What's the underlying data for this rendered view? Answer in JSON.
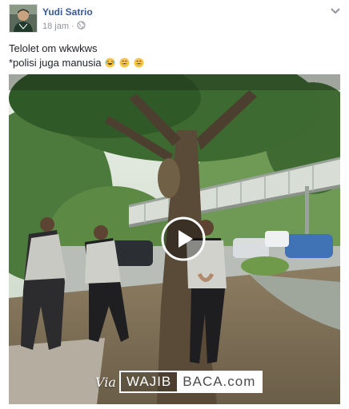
{
  "post": {
    "author": "Yudi Satrio",
    "time": "18 jam",
    "separator": "·",
    "privacy_icon": "globe-icon",
    "menu_icon": "chevron-down-icon",
    "text_line1": "Telolet om wkwkws",
    "text_line2": "*polisi juga manusia",
    "emojis": [
      "laughing-emoji",
      "grinning-emoji",
      "grinning-emoji"
    ]
  },
  "video": {
    "play_icon": "play-icon",
    "watermark": {
      "via": "Via",
      "part1": "WAJIB",
      "part2": "BACA.com"
    }
  },
  "colors": {
    "link": "#365899",
    "meta": "#90949c",
    "text": "#1d2129"
  }
}
